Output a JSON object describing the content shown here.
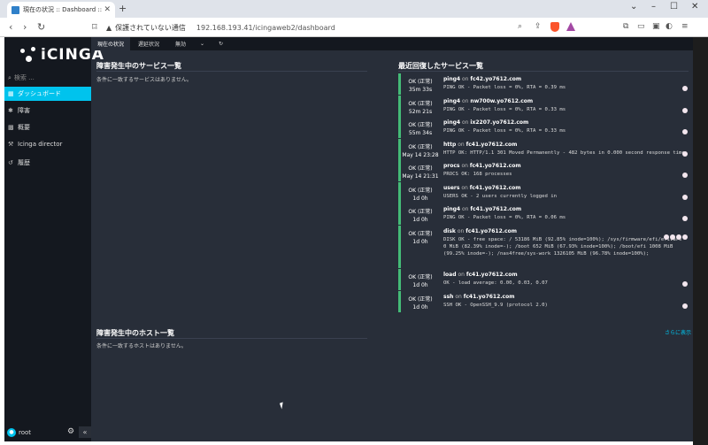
{
  "browser": {
    "tab_title": "現在の状況 :: Dashboard :: Icin",
    "new_tab": "+",
    "security_label": "保護されていない通信",
    "url": "192.168.193.41/icingaweb2/dashboard",
    "window_controls": [
      "⌄",
      "–",
      "☐",
      "✕"
    ]
  },
  "sidebar": {
    "logo": "iCINGA",
    "search_placeholder": "検索 ...",
    "items": [
      {
        "label": "ダッシュボード",
        "icon": "dashboard-icon",
        "active": true
      },
      {
        "label": "障害",
        "icon": "problems-icon",
        "active": false
      },
      {
        "label": "概要",
        "icon": "overview-icon",
        "active": false
      },
      {
        "label": "Icinga director",
        "icon": "director-icon",
        "active": false
      },
      {
        "label": "履歴",
        "icon": "history-icon",
        "active": false
      }
    ],
    "user": "root",
    "collapse": "«"
  },
  "topnav": {
    "tabs": [
      "現在の状況",
      "遅延状況",
      "無効"
    ],
    "dropdown": "⌄",
    "refresh": "↻"
  },
  "services_problem": {
    "title": "障害発生中のサービス一覧",
    "empty": "条件に一致するサービスはありません。"
  },
  "hosts_problem": {
    "title": "障害発生中のホスト一覧",
    "empty": "条件に一致するホストはありません。"
  },
  "recovered": {
    "title": "最近回復したサービス一覧",
    "more": "さらに表示",
    "on": "on",
    "rows": [
      {
        "state": "OK (正常)",
        "time": "35m 33s",
        "service": "ping4",
        "host": "fc42.yo7612.com",
        "output": "PING OK - Packet loss = 0%, RTA = 0.39 ms"
      },
      {
        "state": "OK (正常)",
        "time": "52m 21s",
        "service": "ping4",
        "host": "nw700w.yo7612.com",
        "output": "PING OK - Packet loss = 0%, RTA = 0.33 ms"
      },
      {
        "state": "OK (正常)",
        "time": "55m 34s",
        "service": "ping4",
        "host": "ix2207.yo7612.com",
        "output": "PING OK - Packet loss = 0%, RTA = 0.33 ms"
      },
      {
        "state": "OK (正常)",
        "time": "May 14 23:28",
        "service": "http",
        "host": "fc41.yo7612.com",
        "output": "HTTP OK: HTTP/1.1 301 Moved Permanently - 482 bytes in 0.000 second response time"
      },
      {
        "state": "OK (正常)",
        "time": "May 14 21:31",
        "service": "procs",
        "host": "fc41.yo7612.com",
        "output": "PROCS OK: 168 processes"
      },
      {
        "state": "OK (正常)",
        "time": "1d 0h",
        "service": "users",
        "host": "fc41.yo7612.com",
        "output": "USERS OK - 2 users currently logged in"
      },
      {
        "state": "OK (正常)",
        "time": "1d 0h",
        "service": "ping4",
        "host": "fc41.yo7612.com",
        "output": "PING OK - Packet loss = 0%, RTA = 0.06 ms"
      },
      {
        "state": "OK (正常)",
        "time": "1d 0h",
        "service": "disk",
        "host": "fc41.yo7612.com",
        "output": "DISK OK - free space: / 53186 MiB (92.85% inode=100%); /sys/firmware/efi/efivars 0 MiB (82.39% inode=-); /boot 652 MiB (67.93% inode=100%); /boot/efi 1008 MiB (99.25% inode=-); /nas4free/sys-work 1326105 MiB (96.78% inode=100%);"
      },
      {
        "state": "OK (正常)",
        "time": "1d 0h",
        "service": "load",
        "host": "fc41.yo7612.com",
        "output": "OK - load average: 0.00, 0.03, 0.07"
      },
      {
        "state": "OK (正常)",
        "time": "1d 0h",
        "service": "ssh",
        "host": "fc41.yo7612.com",
        "output": "SSH OK - OpenSSH_9.9 (protocol 2.0)"
      }
    ]
  },
  "colors": {
    "accent": "#00c3ed",
    "ok": "#44bb77",
    "bg": "#282e39",
    "sidebar": "#14181f"
  }
}
